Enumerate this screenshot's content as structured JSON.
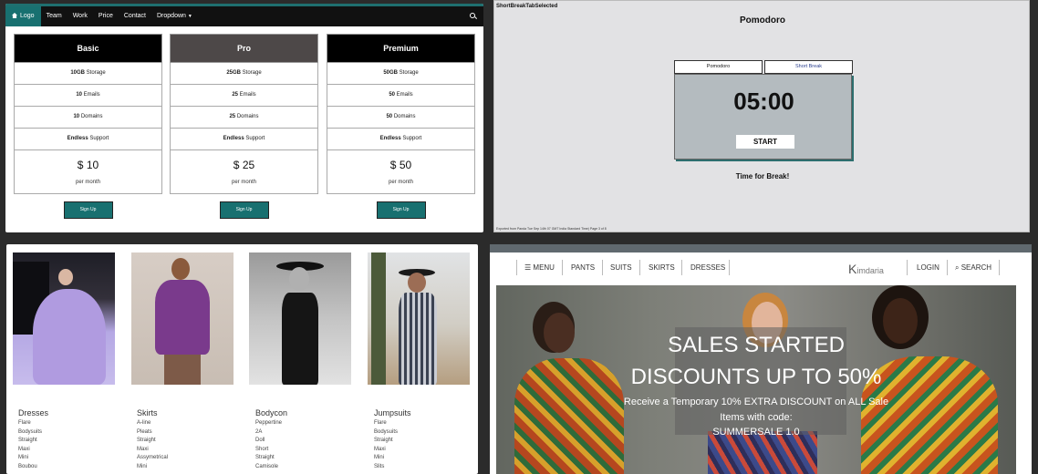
{
  "pricing": {
    "nav": {
      "logo": "Logo",
      "items": [
        "Team",
        "Work",
        "Price",
        "Contact"
      ],
      "dropdown": "Dropdown"
    },
    "accent": "#187070",
    "plans": [
      {
        "name": "Basic",
        "header_color": "#000000",
        "storage": "10GB",
        "emails": "10",
        "domains": "10",
        "support": "Endless",
        "price": "10"
      },
      {
        "name": "Pro",
        "header_color": "#4d4848",
        "storage": "25GB",
        "emails": "25",
        "domains": "25",
        "support": "Endless",
        "price": "25"
      },
      {
        "name": "Premium",
        "header_color": "#000000",
        "storage": "50GB",
        "emails": "50",
        "domains": "50",
        "support": "Endless",
        "price": "50"
      }
    ],
    "labels": {
      "storage": "Storage",
      "emails": "Emails",
      "domains": "Domains",
      "support": "Support",
      "currency": "$",
      "per": "per month",
      "signup": "Sign Up"
    }
  },
  "pomodoro": {
    "window_title": "ShortBreakTabSelected",
    "heading": "Pomodoro",
    "tabs": [
      "Pomodoro",
      "Short Break"
    ],
    "selected_tab": "Short Break",
    "time": "05:00",
    "start": "START",
    "message": "Time for Break!",
    "footer": "Exported from Panda Tue Sep 14th 07 GMT India Standard Time) Page 3 of 8"
  },
  "shop_grid": {
    "categories": [
      {
        "title": "Dresses",
        "items": [
          "Flare",
          "Bodysuits",
          "Straight",
          "Maxi",
          "Mini",
          "Boubou"
        ]
      },
      {
        "title": "Skirts",
        "items": [
          "A-line",
          "Pleats",
          "Straight",
          "Maxi",
          "Assymetrical",
          "Mini"
        ]
      },
      {
        "title": "Bodycon",
        "items": [
          "Peppertine",
          "2A",
          "Doll",
          "Short",
          "Straight",
          "Camisole"
        ]
      },
      {
        "title": "Jumpsuits",
        "items": [
          "Flare",
          "Bodysuits",
          "Straight",
          "Maxi",
          "Mini",
          "Slits"
        ]
      }
    ]
  },
  "fashion": {
    "nav": {
      "menu": "MENU",
      "items": [
        "PANTS",
        "SUITS",
        "SKIRTS",
        "DRESSES"
      ],
      "login": "LOGIN",
      "search": "SEARCH"
    },
    "brand": {
      "initial": "K",
      "rest": "imdaria"
    },
    "hero": {
      "line1": "SALES STARTED",
      "line2": "DISCOUNTS UP TO 50%",
      "line3": "Receive a Temporary 10% EXTRA DISCOUNT on ALL Sale",
      "line4": "Items with code:",
      "line5": "SUMMERSALE 1.0"
    }
  }
}
